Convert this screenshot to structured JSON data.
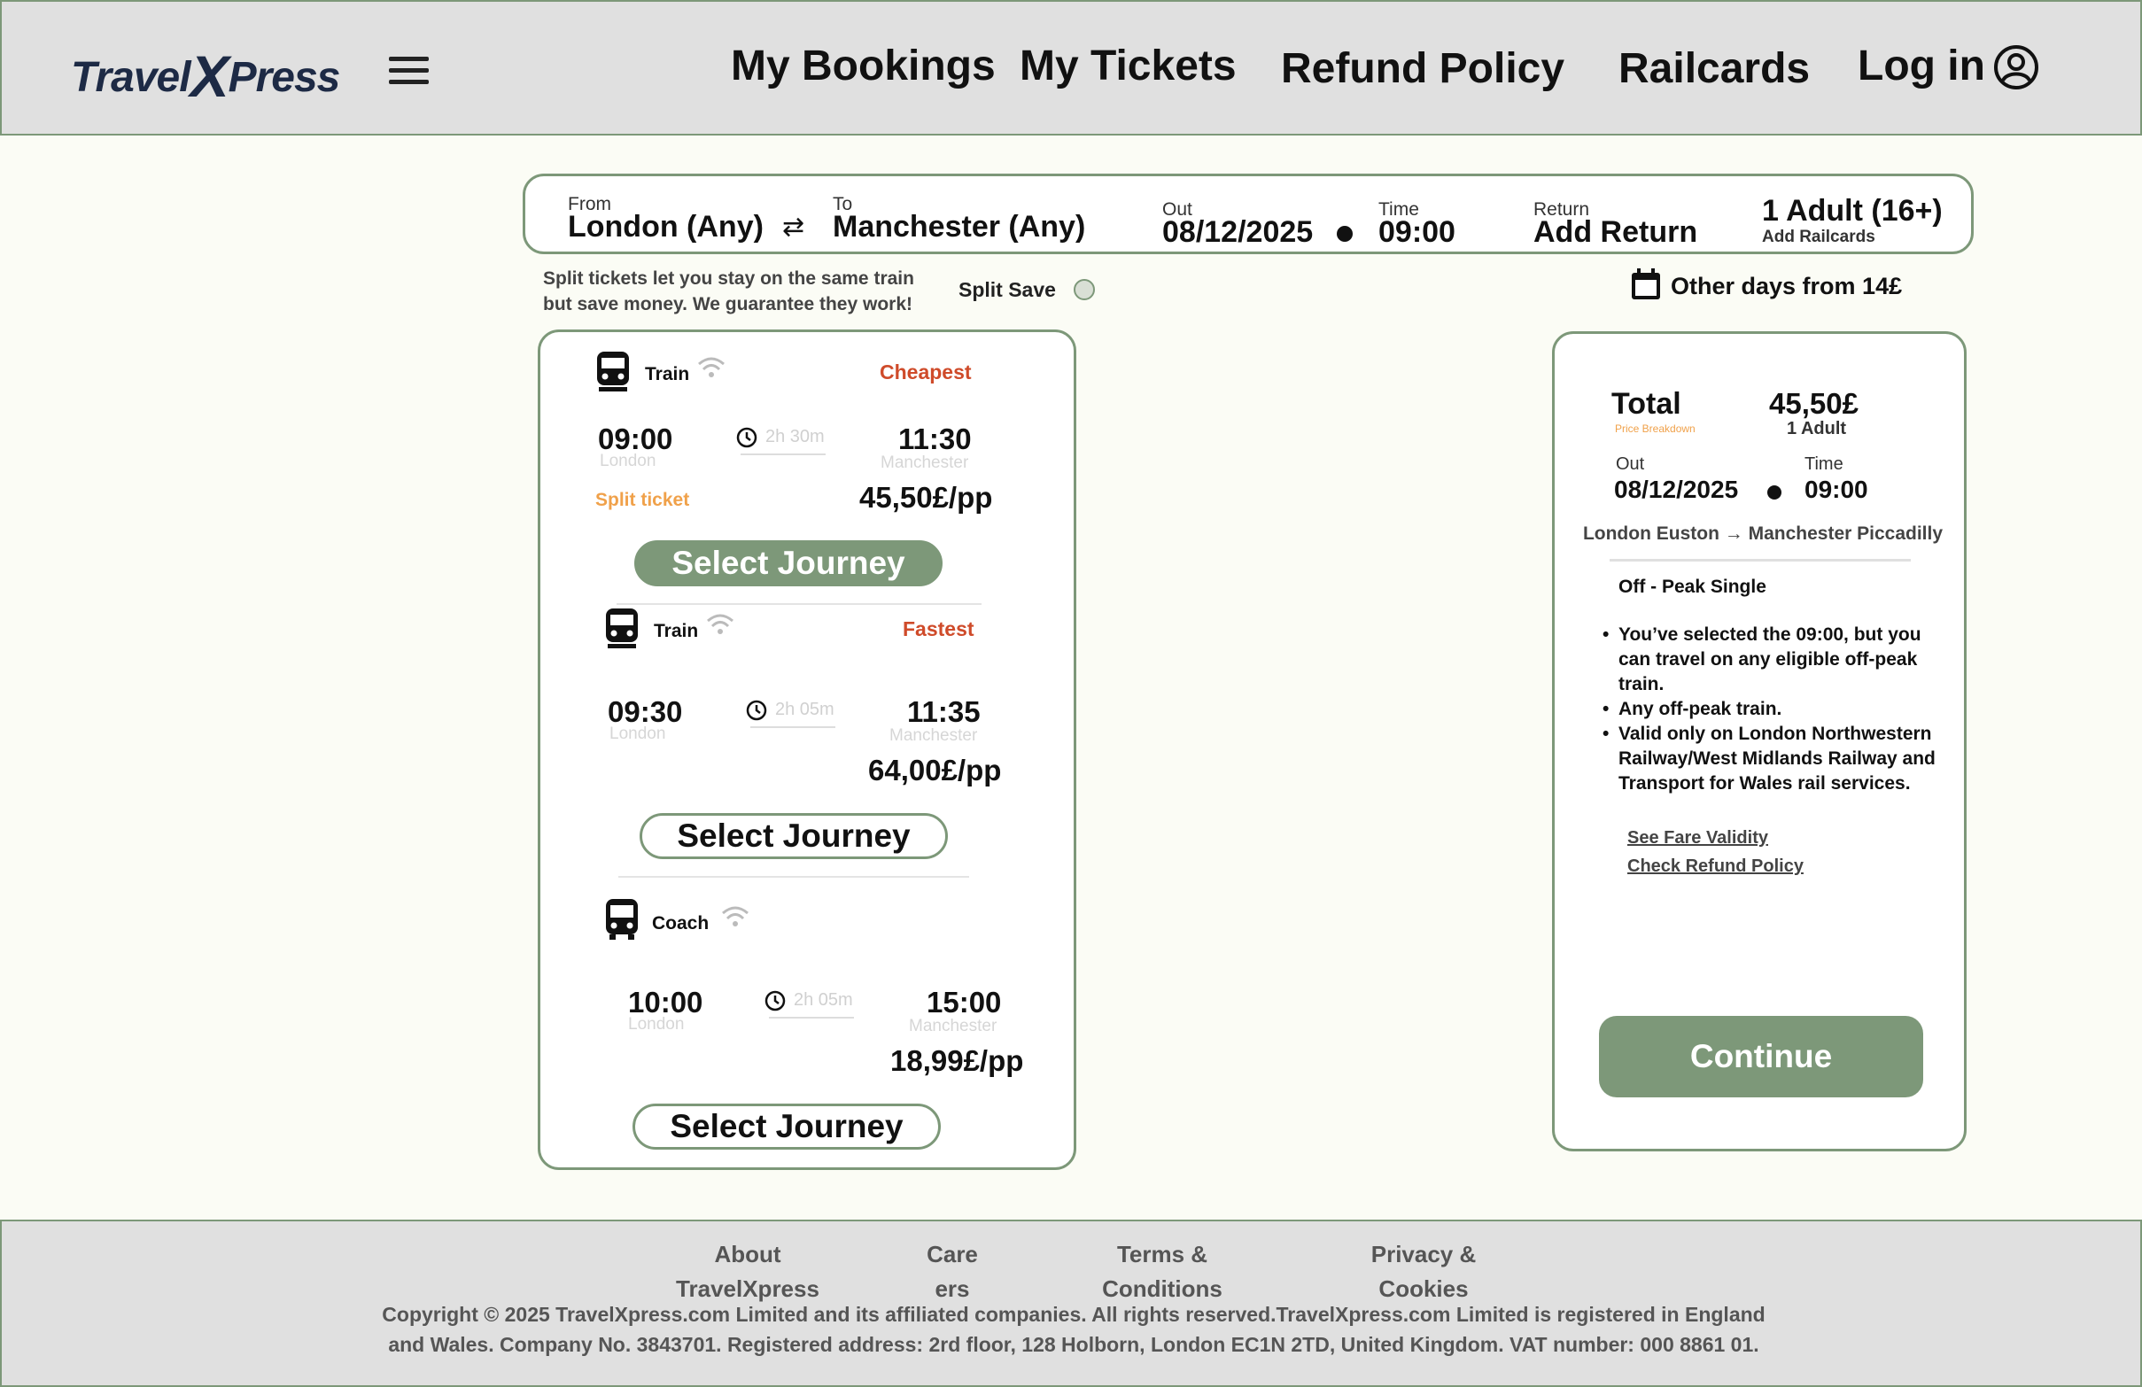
{
  "header": {
    "logo_pre": "Travel",
    "logo_x": "X",
    "logo_post": "Press",
    "nav": [
      "My Bookings",
      "My Tickets",
      "Refund Policy",
      "Railcards",
      "Log in"
    ]
  },
  "search": {
    "from_label": "From",
    "from_value": "London (Any)",
    "to_label": "To",
    "to_value": "Manchester (Any)",
    "out_label": "Out",
    "out_value": "08/12/2025",
    "time_label": "Time",
    "time_value": "09:00",
    "return_label": "Return",
    "return_value": "Add Return",
    "passengers": "1 Adult (16+)",
    "railcards": "Add Railcards",
    "swap_icon": "⇄"
  },
  "split": {
    "text": "Split tickets let you stay on the same train but save money. We guarantee they work!",
    "label": "Split Save"
  },
  "other_days": "Other days from 14£",
  "journeys": [
    {
      "type": "Train",
      "tag": "Cheapest",
      "depart": "09:00",
      "from": "London",
      "duration": "2h 30m",
      "arrive": "11:30",
      "to": "Manchester",
      "note": "Split ticket",
      "price": "45,50£/pp",
      "button": "Select Journey"
    },
    {
      "type": "Train",
      "tag": "Fastest",
      "depart": "09:30",
      "from": "London",
      "duration": "2h 05m",
      "arrive": "11:35",
      "to": "Manchester",
      "note": "",
      "price": "64,00£/pp",
      "button": "Select Journey"
    },
    {
      "type": "Coach",
      "tag": "",
      "depart": "10:00",
      "from": "London",
      "duration": "2h 05m",
      "arrive": "15:00",
      "to": "Manchester",
      "note": "",
      "price": "18,99£/pp",
      "button": "Select Journey"
    }
  ],
  "summary": {
    "total_label": "Total",
    "breakdown": "Price Breakdown",
    "amount": "45,50£",
    "adults": "1 Adult",
    "out_label": "Out",
    "out_value": "08/12/2025",
    "time_label": "Time",
    "time_value": "09:00",
    "route": "London Euston → Manchester Piccadilly",
    "fare": "Off - Peak Single",
    "bullets": [
      "You’ve selected the 09:00, but you can travel on any eligible off-peak train.",
      "Any off-peak train.",
      "Valid only on London Northwestern Railway/West Midlands Railway and Transport for Wales rail services."
    ],
    "link_validity": "See Fare Validity",
    "link_refund": "Check Refund Policy",
    "continue": "Continue"
  },
  "footer": {
    "links": [
      {
        "line1": "About",
        "line2": "TravelXpress"
      },
      {
        "line1": "Care",
        "line2": "ers"
      },
      {
        "line1": "Terms &",
        "line2": "Conditions"
      },
      {
        "line1": "Privacy &",
        "line2": "Cookies"
      }
    ],
    "copyright_1": "Copyright © 2025 TravelXpress.com Limited and its affiliated companies. All rights reserved.TravelXpress.com Limited is registered in England",
    "copyright_2": "and Wales. Company No. 3843701. Registered address: 2rd floor, 128 Holborn, London EC1N 2TD, United Kingdom. VAT number: 000 8861 01."
  },
  "colors": {
    "accent": "#7d9879",
    "tag": "#cf4b2a",
    "split_ticket": "#f0a14a",
    "header_bg": "#e0e0e0",
    "page_bg": "#fbfcf5"
  }
}
